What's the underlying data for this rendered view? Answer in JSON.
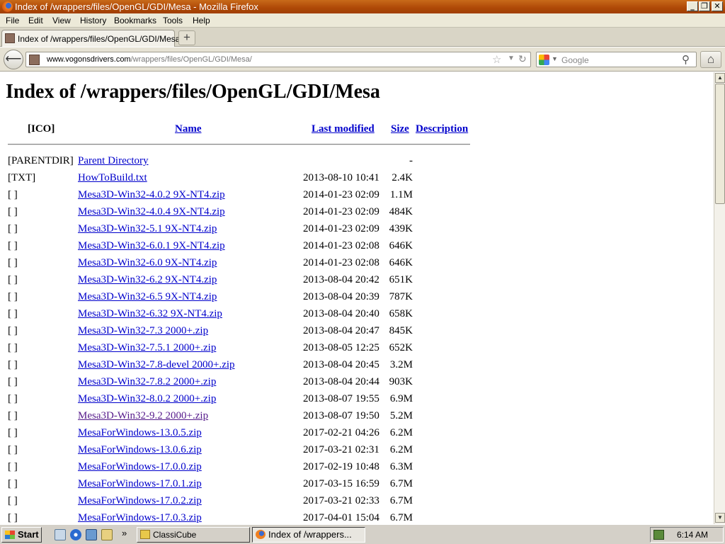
{
  "window": {
    "title": "Index of /wrappers/files/OpenGL/GDI/Mesa - Mozilla Firefox",
    "controls": [
      "_",
      "❐",
      "✕"
    ]
  },
  "menu": [
    "File",
    "Edit",
    "View",
    "History",
    "Bookmarks",
    "Tools",
    "Help"
  ],
  "tab": {
    "label": "Index of /wrappers/files/OpenGL/GDI/Mesa",
    "new_tab": "+"
  },
  "nav": {
    "url_domain": "www.vogonsdrivers.com",
    "url_path": "/wrappers/files/OpenGL/GDI/Mesa/",
    "search_placeholder": "Google"
  },
  "page": {
    "heading": "Index of /wrappers/files/OpenGL/GDI/Mesa",
    "columns": {
      "icon": "[ICO]",
      "name": "Name",
      "modified": "Last modified",
      "size": "Size",
      "description": "Description"
    },
    "rows": [
      {
        "icon": "[PARENTDIR]",
        "name": "Parent Directory",
        "date": "",
        "size": "-"
      },
      {
        "icon": "[TXT]",
        "name": "HowToBuild.txt",
        "date": "2013-08-10 10:41",
        "size": "2.4K"
      },
      {
        "icon": "[ ]",
        "name": "Mesa3D-Win32-4.0.2 9X-NT4.zip",
        "date": "2014-01-23 02:09",
        "size": "1.1M"
      },
      {
        "icon": "[ ]",
        "name": "Mesa3D-Win32-4.0.4 9X-NT4.zip",
        "date": "2014-01-23 02:09",
        "size": "484K"
      },
      {
        "icon": "[ ]",
        "name": "Mesa3D-Win32-5.1 9X-NT4.zip",
        "date": "2014-01-23 02:09",
        "size": "439K"
      },
      {
        "icon": "[ ]",
        "name": "Mesa3D-Win32-6.0.1 9X-NT4.zip",
        "date": "2014-01-23 02:08",
        "size": "646K"
      },
      {
        "icon": "[ ]",
        "name": "Mesa3D-Win32-6.0 9X-NT4.zip",
        "date": "2014-01-23 02:08",
        "size": "646K"
      },
      {
        "icon": "[ ]",
        "name": "Mesa3D-Win32-6.2 9X-NT4.zip",
        "date": "2013-08-04 20:42",
        "size": "651K"
      },
      {
        "icon": "[ ]",
        "name": "Mesa3D-Win32-6.5 9X-NT4.zip",
        "date": "2013-08-04 20:39",
        "size": "787K"
      },
      {
        "icon": "[ ]",
        "name": "Mesa3D-Win32-6.32 9X-NT4.zip",
        "date": "2013-08-04 20:40",
        "size": "658K"
      },
      {
        "icon": "[ ]",
        "name": "Mesa3D-Win32-7.3 2000+.zip",
        "date": "2013-08-04 20:47",
        "size": "845K"
      },
      {
        "icon": "[ ]",
        "name": "Mesa3D-Win32-7.5.1 2000+.zip",
        "date": "2013-08-05 12:25",
        "size": "652K"
      },
      {
        "icon": "[ ]",
        "name": "Mesa3D-Win32-7.8-devel 2000+.zip",
        "date": "2013-08-04 20:45",
        "size": "3.2M"
      },
      {
        "icon": "[ ]",
        "name": "Mesa3D-Win32-7.8.2 2000+.zip",
        "date": "2013-08-04 20:44",
        "size": "903K"
      },
      {
        "icon": "[ ]",
        "name": "Mesa3D-Win32-8.0.2 2000+.zip",
        "date": "2013-08-07 19:55",
        "size": "6.9M"
      },
      {
        "icon": "[ ]",
        "name": "Mesa3D-Win32-9.2 2000+.zip",
        "date": "2013-08-07 19:50",
        "size": "5.2M",
        "visited": true
      },
      {
        "icon": "[ ]",
        "name": "MesaForWindows-13.0.5.zip",
        "date": "2017-02-21 04:26",
        "size": "6.2M"
      },
      {
        "icon": "[ ]",
        "name": "MesaForWindows-13.0.6.zip",
        "date": "2017-03-21 02:31",
        "size": "6.2M"
      },
      {
        "icon": "[ ]",
        "name": "MesaForWindows-17.0.0.zip",
        "date": "2017-02-19 10:48",
        "size": "6.3M"
      },
      {
        "icon": "[ ]",
        "name": "MesaForWindows-17.0.1.zip",
        "date": "2017-03-15 16:59",
        "size": "6.7M"
      },
      {
        "icon": "[ ]",
        "name": "MesaForWindows-17.0.2.zip",
        "date": "2017-03-21 02:33",
        "size": "6.7M"
      },
      {
        "icon": "[ ]",
        "name": "MesaForWindows-17.0.3.zip",
        "date": "2017-04-01 15:04",
        "size": "6.7M"
      }
    ]
  },
  "taskbar": {
    "start": "Start",
    "quicklaunch_overflow": "»",
    "buttons": [
      {
        "label": "ClassiCube",
        "icon": "folder-icon"
      },
      {
        "label": "Index of /wrappers...",
        "icon": "firefox-icon",
        "active": true
      }
    ],
    "clock": "6:14 AM"
  },
  "colors": {
    "link": "#0000cc",
    "visited": "#551a8b",
    "titlebar": "#b04a08"
  }
}
